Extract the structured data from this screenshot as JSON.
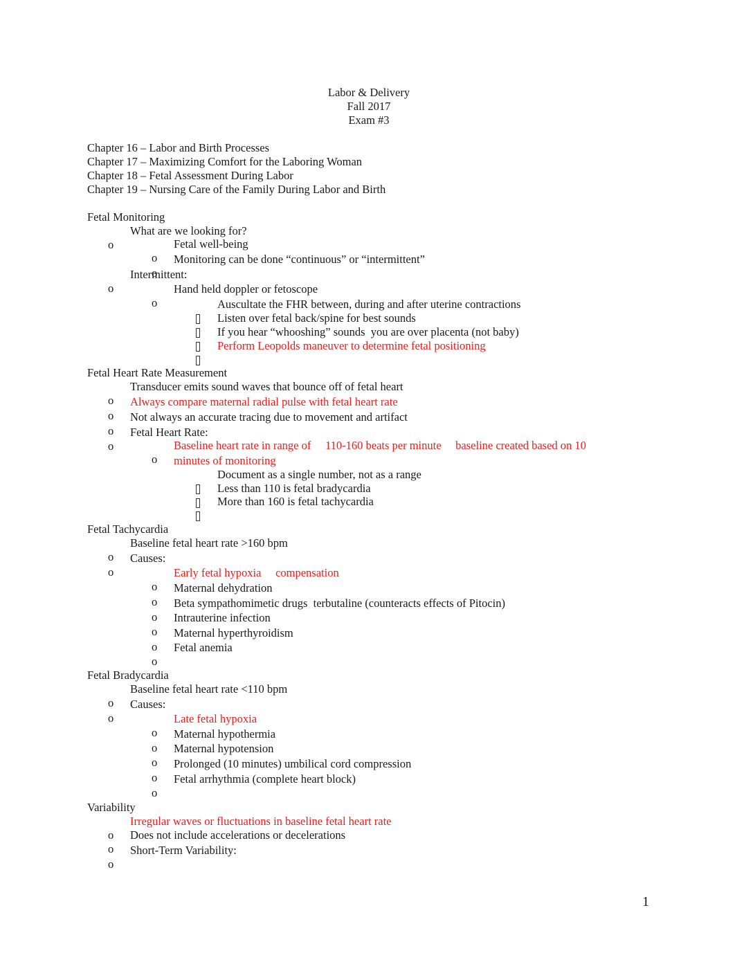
{
  "header": {
    "title": "Labor & Delivery",
    "term": "Fall 2017",
    "exam": "Exam #3"
  },
  "chapters": [
    "Chapter 16 – Labor and Birth Processes",
    "Chapter 17 – Maximizing Comfort for the Laboring Woman",
    "Chapter 18 – Fetal Assessment During Labor",
    "Chapter 19 – Nursing Care of the Family During Labor and Birth"
  ],
  "fetal_monitoring": {
    "heading": "Fetal Monitoring",
    "looking_for": "What are we looking for?",
    "well_being": "Fetal well-being",
    "continuous": "Monitoring can be done “continuous” or “intermittent”",
    "intermittent": "Intermittent:",
    "doppler": "Hand held doppler or fetoscope",
    "auscultate": "Auscultate the FHR between, during and after uterine contractions",
    "listen": "Listen over fetal back/spine for best sounds",
    "whooshing": "If you hear “whooshing” sounds  you are over placenta (not baby)",
    "leopolds": "Perform Leopolds maneuver to determine fetal positioning"
  },
  "fhr_measurement": {
    "heading": "Fetal Heart Rate Measurement",
    "transducer": "Transducer emits sound waves that bounce off of fetal heart",
    "compare": "Always compare maternal radial pulse with fetal heart rate",
    "accuracy": "Not always an accurate tracing due to movement and artifact",
    "fhr": "Fetal Heart Rate:",
    "baseline_line1": "Baseline heart rate in range of     110-160 beats per minute     baseline created based on 10",
    "baseline_line2": "minutes of monitoring",
    "document": "Document as a single number, not as a range",
    "less": "Less than 110 is fetal bradycardia",
    "more": "More than 160 is fetal tachycardia"
  },
  "tachycardia": {
    "heading": "Fetal Tachycardia",
    "baseline": "Baseline fetal heart rate >160 bpm",
    "causes": "Causes:",
    "causes_list": [
      "Early fetal hypoxia     compensation",
      "Maternal dehydration",
      "Beta sympathomimetic drugs  terbutaline (counteracts effects of Pitocin)",
      "Intrauterine infection",
      "Maternal hyperthyroidism",
      "Fetal anemia"
    ]
  },
  "bradycardia": {
    "heading": "Fetal Bradycardia",
    "baseline": "Baseline fetal heart rate <110 bpm",
    "causes": "Causes:",
    "causes_list": [
      "Late fetal hypoxia",
      "Maternal hypothermia",
      "Maternal hypotension",
      "Prolonged (10 minutes) umbilical cord compression",
      "Fetal arrhythmia (complete heart block)"
    ]
  },
  "variability": {
    "heading": "Variability",
    "irregular": "Irregular waves or fluctuations in baseline fetal heart rate",
    "not_include": "Does not include accelerations or decelerations",
    "short_term": "Short-Term Variability:"
  },
  "bullets": {
    "level1": "o",
    "level2": "o"
  },
  "colors": {
    "text": "#1a1a1a",
    "highlight": "#ee1c1c"
  },
  "page_number": "1"
}
